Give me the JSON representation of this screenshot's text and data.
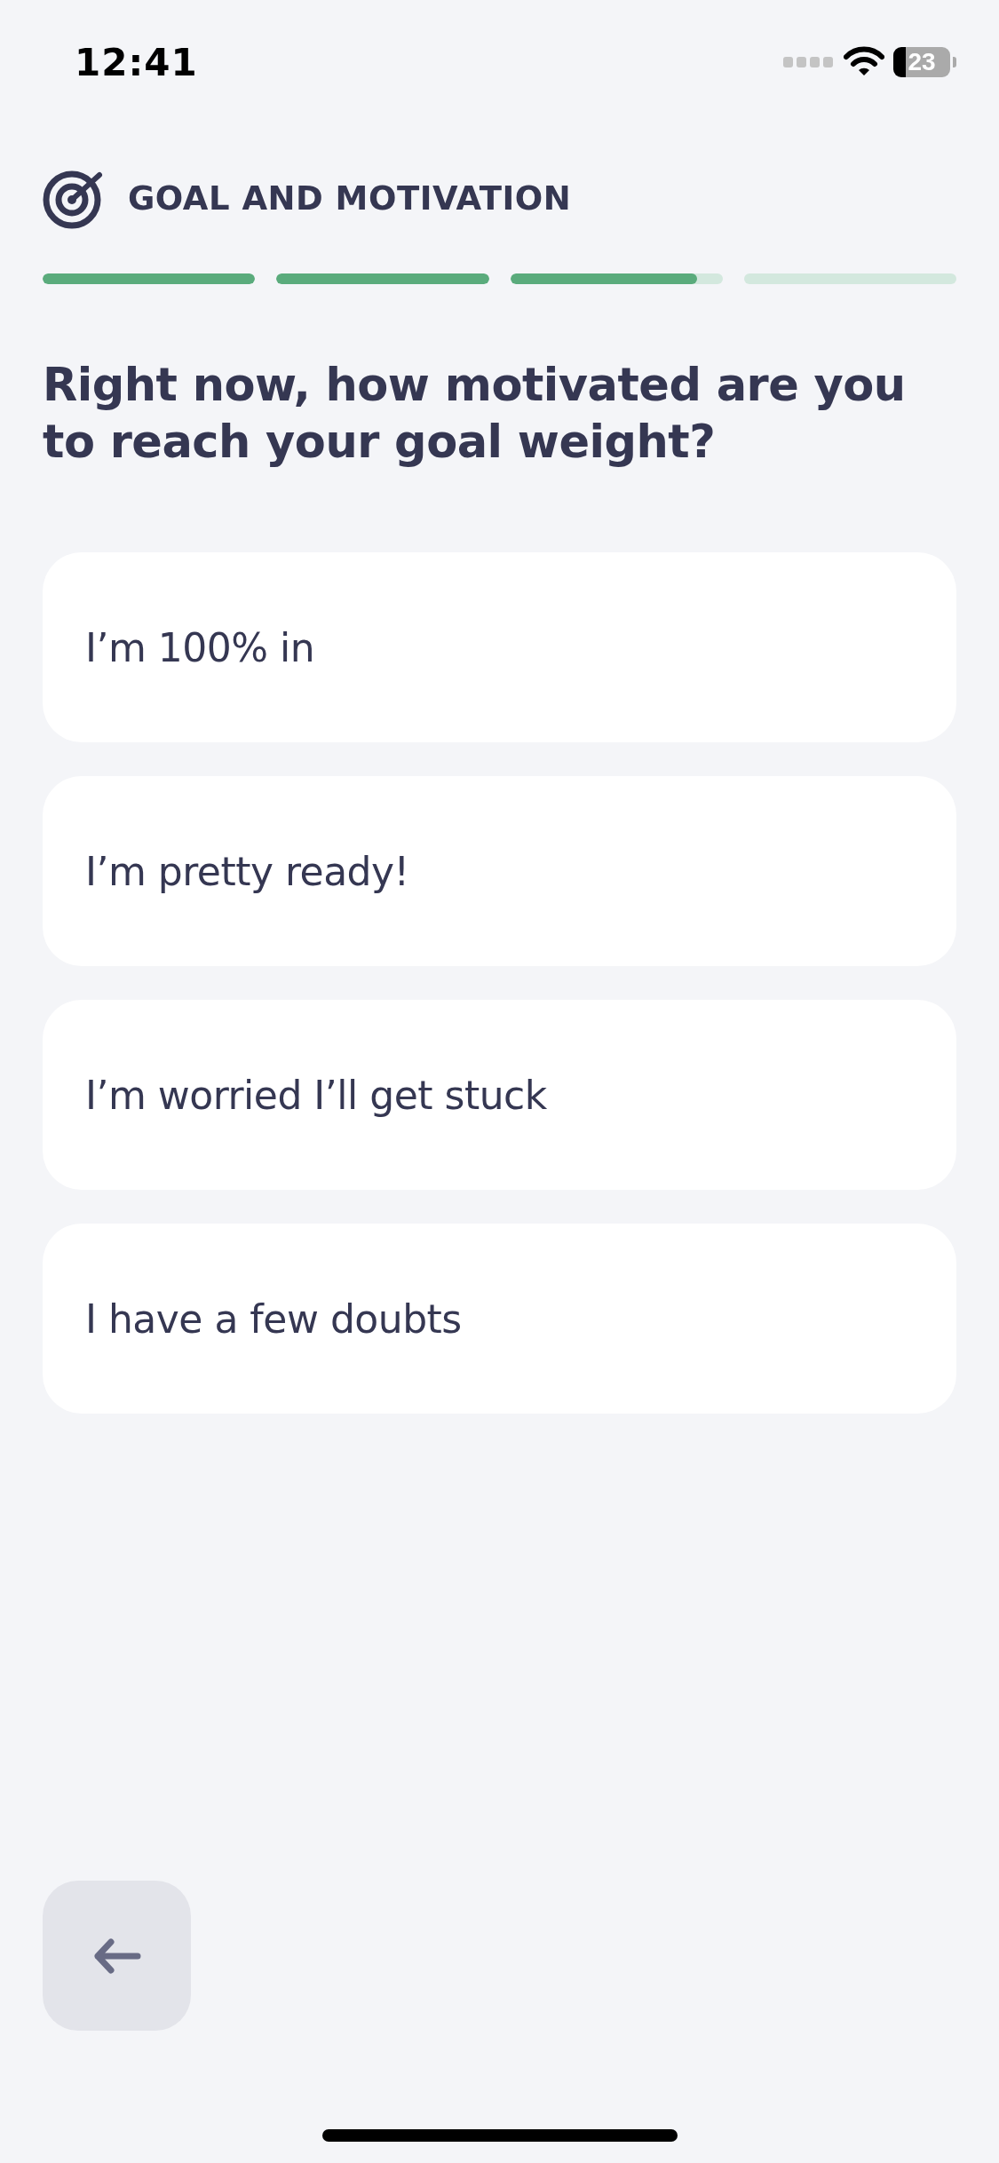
{
  "status_bar": {
    "time": "12:41",
    "battery": "23"
  },
  "header": {
    "title": "GOAL AND MOTIVATION"
  },
  "progress": [
    {
      "level": 1
    },
    {
      "level": 1
    },
    {
      "level": 0.88
    },
    {
      "level": 0
    }
  ],
  "question": "Right now, how motivated are you to reach your goal weight?",
  "options": [
    {
      "label": "I’m 100% in"
    },
    {
      "label": "I’m pretty ready!"
    },
    {
      "label": "I’m worried I’ll get stuck"
    },
    {
      "label": "I have a few doubts"
    }
  ]
}
